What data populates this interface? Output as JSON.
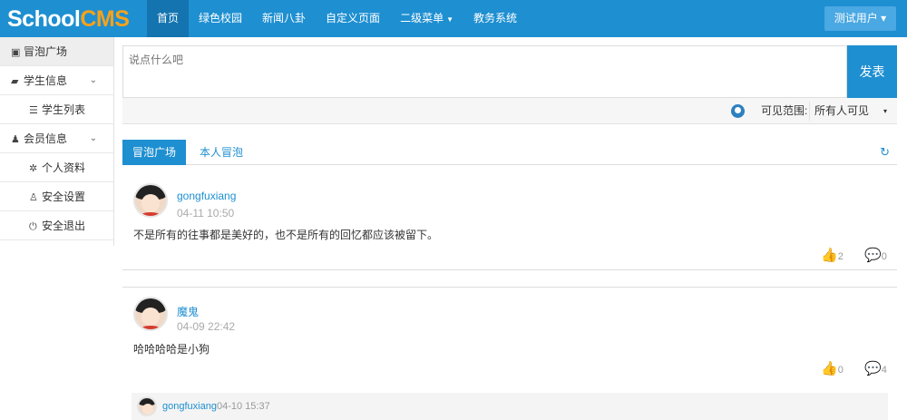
{
  "header": {
    "logo_part1": "School",
    "logo_part2": "CMS",
    "nav": [
      {
        "label": "首页",
        "active": true
      },
      {
        "label": "绿色校园"
      },
      {
        "label": "新闻八卦"
      },
      {
        "label": "自定义页面"
      },
      {
        "label": "二级菜单",
        "dropdown": true
      },
      {
        "label": "教务系统"
      }
    ],
    "user_label": "测试用户",
    "user_caret": "▾"
  },
  "sidebar": {
    "items": [
      {
        "label": "冒泡广场",
        "icon": "bubble-icon",
        "glyph": "▣"
      },
      {
        "label": "学生信息",
        "icon": "students-icon",
        "glyph": "▰",
        "chevron": "⌄"
      },
      {
        "label": "学生列表",
        "icon": "list-icon",
        "glyph": "☰"
      },
      {
        "label": "会员信息",
        "icon": "user-icon",
        "glyph": "♟",
        "chevron": "⌄"
      },
      {
        "label": "个人资料",
        "icon": "gear-icon",
        "glyph": "✲"
      },
      {
        "label": "安全设置",
        "icon": "lock-icon",
        "glyph": "♙"
      },
      {
        "label": "安全退出",
        "icon": "power-icon",
        "glyph": "⏻"
      }
    ]
  },
  "composer": {
    "placeholder": "说点什么吧",
    "submit_label": "发表",
    "privacy_label": "可见范围:",
    "privacy_value": "所有人可见",
    "privacy_caret": "▾"
  },
  "tabs": {
    "square": "冒泡广场",
    "mine": "本人冒泡",
    "refresh_glyph": "↻"
  },
  "posts": [
    {
      "author": "gongfuxiang",
      "time": "04-11 10:50",
      "content": "不是所有的往事都是美好的，也不是所有的回忆都应该被留下。",
      "likes": "2",
      "comments": "0"
    },
    {
      "author": "魔鬼",
      "time": "04-09 22:42",
      "content": "哈哈哈哈是小狗",
      "likes": "0",
      "comments": "4",
      "reply": {
        "author": "gongfuxiang",
        "time": "04-10 15:37"
      }
    }
  ],
  "icons": {
    "like_glyph": "👍",
    "comment_glyph": "💬"
  },
  "colors": {
    "primary": "#1e8fd1",
    "accent": "#f7a21b"
  }
}
